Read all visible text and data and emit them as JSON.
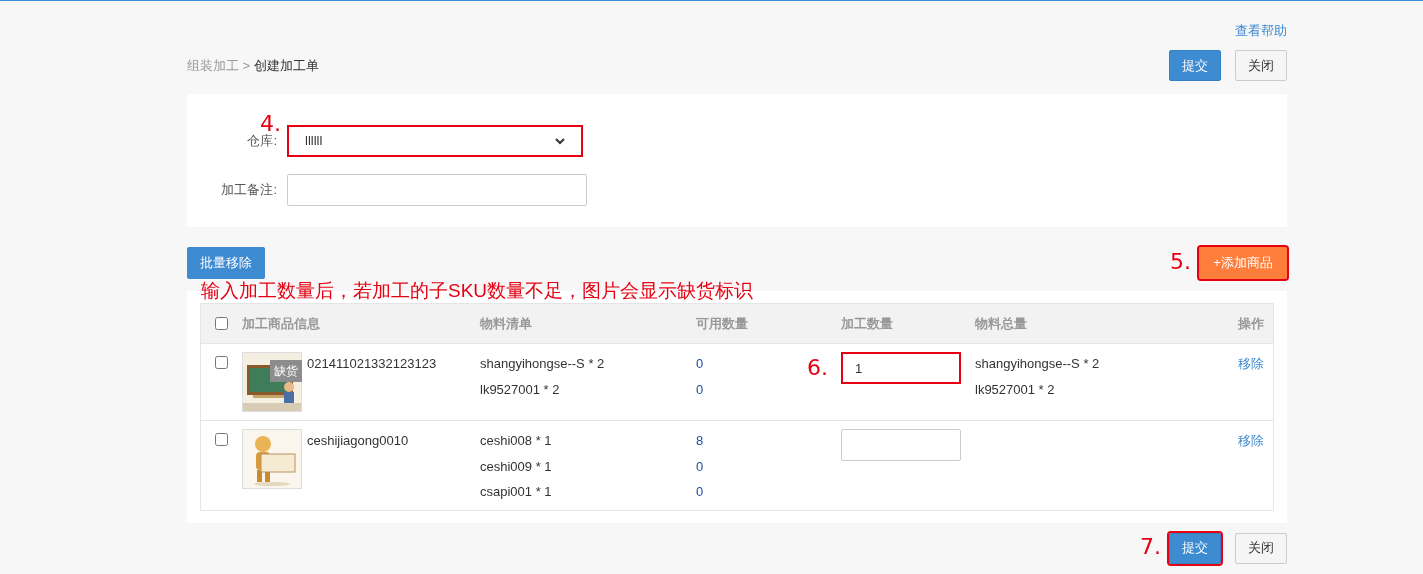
{
  "help_link": "查看帮助",
  "breadcrumb": [
    {
      "text": "组装加工 > ",
      "current": false
    },
    {
      "text": "创建加工单",
      "current": true
    }
  ],
  "header_buttons": [
    {
      "label": "提交",
      "kind": "primary"
    },
    {
      "label": "关闭",
      "kind": "default"
    }
  ],
  "form": {
    "fields": [
      {
        "label": "仓库:",
        "kind": "select",
        "value": "llllll",
        "annotation": "4."
      },
      {
        "label": "加工备注:",
        "kind": "text"
      }
    ]
  },
  "toolbar": {
    "batch_remove": "批量移除",
    "add_product": {
      "label": "+添加商品",
      "annotation": "5."
    }
  },
  "note": "输入加工数量后，若加工的子SKU数量不足，图片会显示缺货标识",
  "table": {
    "select_all": false,
    "columns": [
      "加工商品信息",
      "物料清单",
      "可用数量",
      "加工数量",
      "物料总量",
      "操作"
    ],
    "rows": [
      {
        "checked": false,
        "image": {
          "kind": "picture"
        },
        "badge": "缺货",
        "name": "021411021332123123",
        "materials": [
          {
            "item": "shangyihongse--S * 2",
            "available": "0"
          },
          {
            "item": "lk9527001 * 2",
            "available": "0"
          }
        ],
        "quantity": "1",
        "annotation": "6.",
        "totals": [
          "shangyihongse--S * 2",
          "lk9527001 * 2"
        ],
        "action": "移除"
      },
      {
        "checked": false,
        "image": {
          "kind": "picture"
        },
        "name": "ceshijiagong0010",
        "materials": [
          {
            "item": "ceshi008 * 1",
            "available": "8"
          },
          {
            "item": "ceshi009 * 1",
            "available": "0"
          },
          {
            "item": "csapi001 * 1",
            "available": "0"
          }
        ],
        "totals": [],
        "action": "移除"
      }
    ]
  },
  "footer_buttons": [
    {
      "label": "提交",
      "kind": "primary",
      "annotation": "7."
    },
    {
      "label": "关闭",
      "kind": "default"
    }
  ]
}
